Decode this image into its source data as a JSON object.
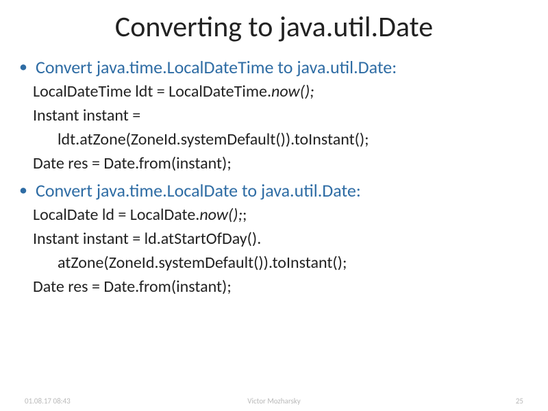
{
  "title": "Converting to java.util.Date",
  "sections": [
    {
      "heading": "Convert java.time.LocalDateTime to java.util.Date:",
      "lines": [
        {
          "pre": "LocalDateTime ldt = LocalDateTime.",
          "ital": "now();",
          "post": "",
          "indent": false
        },
        {
          "pre": "Instant instant =",
          "ital": "",
          "post": "",
          "indent": false
        },
        {
          "pre": "ldt.atZone(ZoneId.systemDefault()).toInstant();",
          "ital": "",
          "post": "",
          "indent": true
        },
        {
          "pre": "Date res = Date.from(instant);",
          "ital": "",
          "post": "",
          "indent": false
        }
      ]
    },
    {
      "heading": "Convert java.time.LocalDate to java.util.Date:",
      "lines": [
        {
          "pre": "LocalDate ld = LocalDate.",
          "ital": "now();",
          "post": ";",
          "indent": false
        },
        {
          "pre": "Instant instant = ld.atStartOfDay().",
          "ital": "",
          "post": "",
          "indent": false
        },
        {
          "pre": "atZone(ZoneId.systemDefault()).toInstant();",
          "ital": "",
          "post": "",
          "indent": true
        },
        {
          "pre": "Date res = Date.from(instant);",
          "ital": "",
          "post": "",
          "indent": false
        }
      ]
    }
  ],
  "footer": {
    "left": "01.08.17 08:43",
    "center": "Victor Mozharsky",
    "right": "25"
  }
}
